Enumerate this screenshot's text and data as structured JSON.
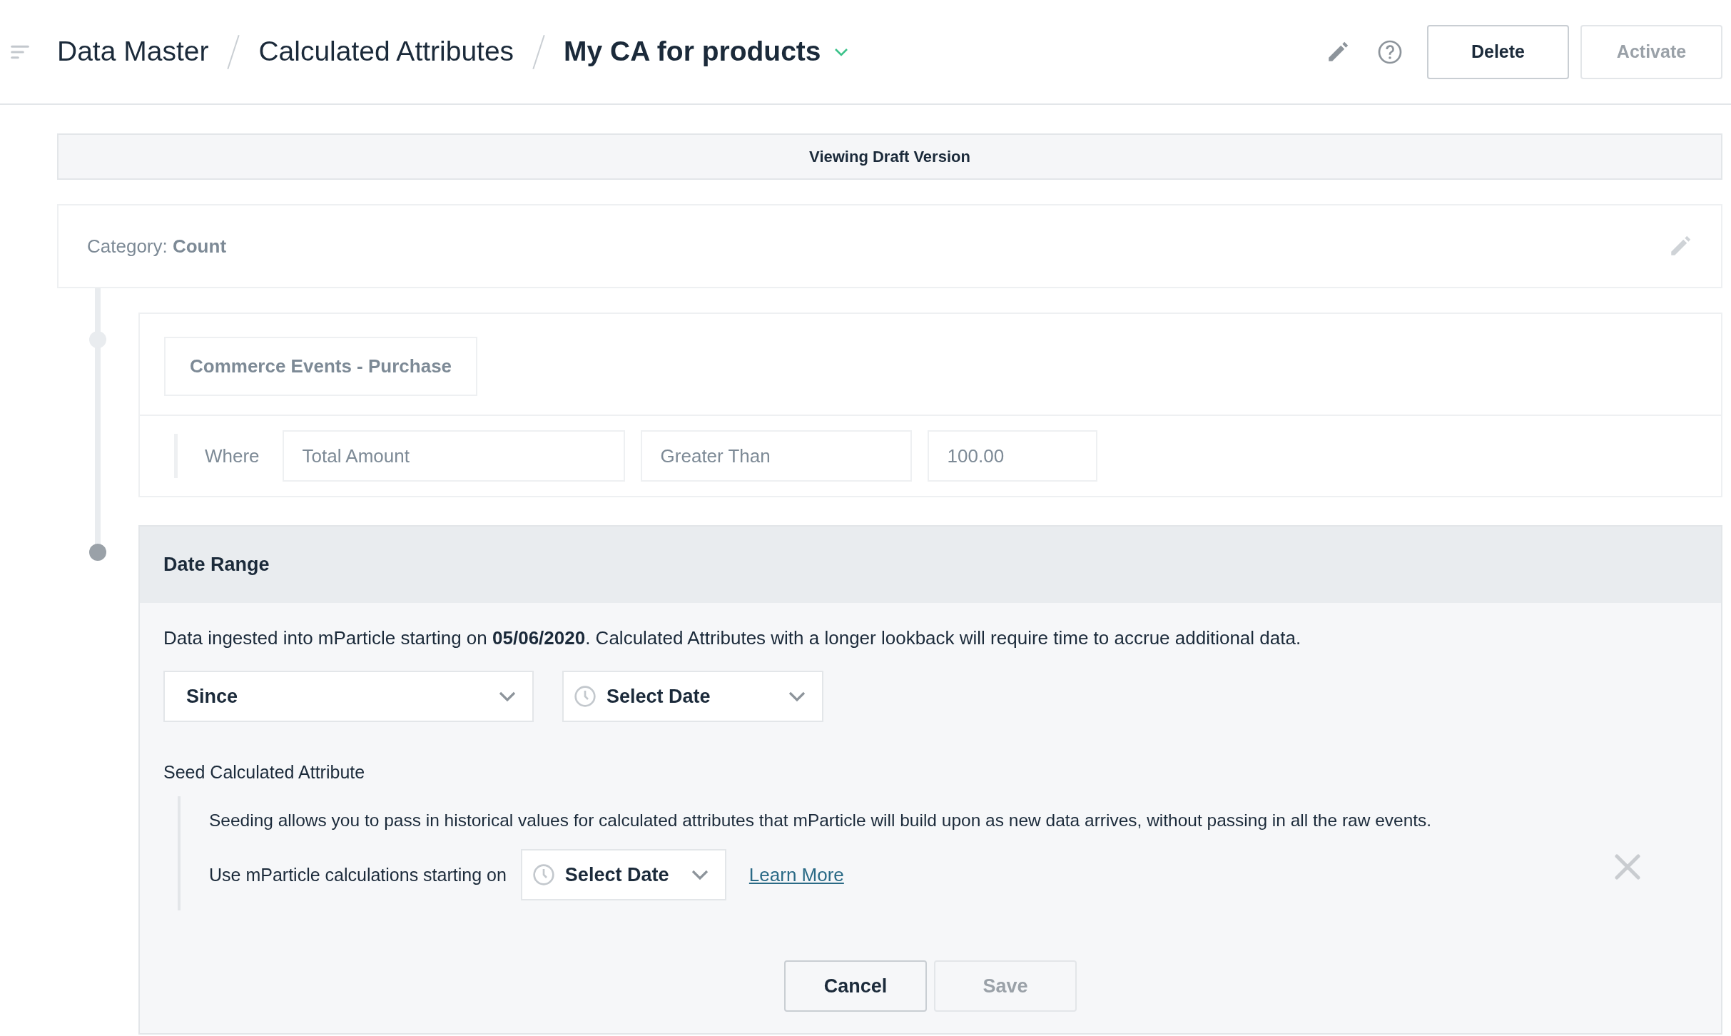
{
  "header": {
    "breadcrumbs": [
      {
        "label": "Data Master",
        "current": false
      },
      {
        "label": "Calculated Attributes",
        "current": false
      },
      {
        "label": "My CA for products",
        "current": true
      }
    ],
    "buttons": [
      {
        "label": "Delete",
        "disabled": false
      },
      {
        "label": "Activate",
        "disabled": true
      }
    ]
  },
  "banner": "Viewing Draft Version",
  "category": {
    "label": "Category:",
    "value": "Count"
  },
  "event_step": {
    "active": false,
    "event": "Commerce Events - Purchase",
    "condition": {
      "label": "Where",
      "attribute": "Total Amount",
      "operator": "Greater Than",
      "value": "100.00"
    }
  },
  "date_range": {
    "active": true,
    "title": "Date Range",
    "notice": "Data ingested into mParticle starting on **05/06/2020**. Calculated Attributes with a longer lookback will require time to accrue additional data.",
    "range_type": "Since",
    "date": "Select Date",
    "seed": {
      "title": "Seed Calculated Attribute",
      "description": "Seeding allows you to pass in historical values for calculated attributes that mParticle will build upon as new data arrives, without passing in all the raw events.",
      "start_label": "Use mParticle calculations starting on",
      "date": "Select Date",
      "link": "Learn More"
    },
    "buttons": [
      {
        "label": "Cancel",
        "disabled": false
      },
      {
        "label": "Save",
        "disabled": true
      }
    ]
  }
}
